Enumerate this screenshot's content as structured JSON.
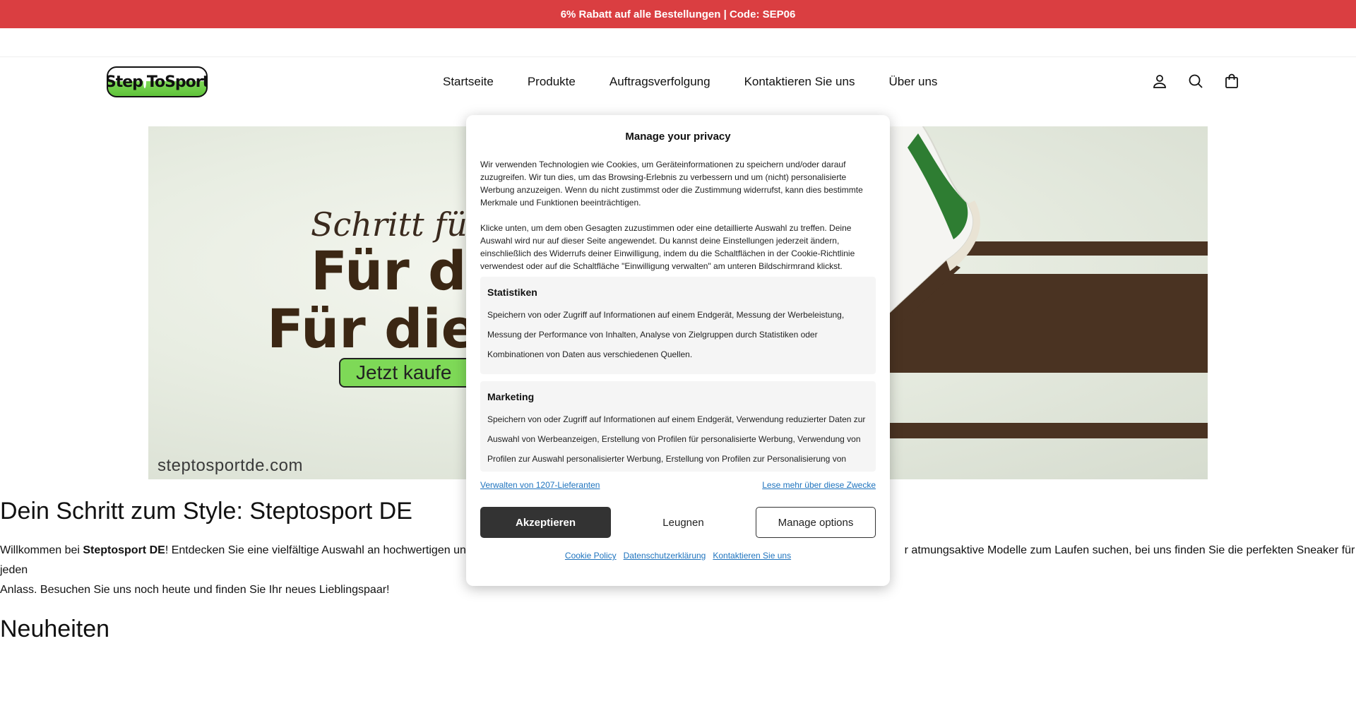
{
  "promo": {
    "text": "6% Rabatt auf alle Bestellungen | Code: SEP06"
  },
  "logo": {
    "text_left": "Step",
    "text_mid": "To",
    "text_right": "Sport"
  },
  "nav": {
    "items": [
      "Startseite",
      "Produkte",
      "Auftragsverfolgung",
      "Kontaktieren Sie uns",
      "Über uns"
    ]
  },
  "icons": [
    "account-icon",
    "search-icon",
    "cart-icon"
  ],
  "hero": {
    "script_text": "Schritt für St",
    "headline_1": "Für di",
    "headline_2": "Für die",
    "cta": "Jetzt kaufe",
    "domain": "steptosportde.com"
  },
  "content": {
    "heading": "Dein Schritt zum Style: Steptosport DE",
    "intro_prefix": "Willkommen bei ",
    "intro_brand": "Steptosport DE",
    "intro_visible_1": "! Entdecken Sie eine vielfältige Auswahl an hochwertigen und st",
    "intro_visible_2": "r atmungsaktive Modelle zum Laufen suchen, bei uns finden Sie die perfekten Sneaker für jeden",
    "intro_line_2": "Anlass. Besuchen Sie uns noch heute und finden Sie Ihr neues Lieblingspaar!",
    "section_heading": "Neuheiten"
  },
  "consent": {
    "title": "Manage your privacy",
    "paragraph_1": "Wir verwenden Technologien wie Cookies, um Geräteinformationen zu speichern und/oder darauf zuzugreifen. Wir tun dies, um das Browsing-Erlebnis zu verbessern und um (nicht) personalisierte Werbung anzuzeigen. Wenn du nicht zustimmst oder die Zustimmung widerrufst, kann dies bestimmte Merkmale und Funktionen beeinträchtigen.",
    "paragraph_2": "Klicke unten, um dem oben Gesagten zuzustimmen oder eine detaillierte Auswahl zu treffen. Deine Auswahl wird nur auf dieser Seite angewendet. Du kannst deine Einstellungen jederzeit ändern, einschließlich des Widerrufs deiner Einwilligung, indem du die Schaltflächen in der Cookie-Richtlinie verwendest oder auf die Schaltfläche \"Einwilligung verwalten\" am unteren Bildschirmrand klickst.",
    "categories": [
      {
        "title": "Statistiken",
        "description": "Speichern von oder Zugriff auf Informationen auf einem Endgerät, Messung der Werbeleistung, Messung der Performance von Inhalten, Analyse von Zielgruppen durch Statistiken oder Kombinationen von Daten aus verschiedenen Quellen."
      },
      {
        "title": "Marketing",
        "description": "Speichern von oder Zugriff auf Informationen auf einem Endgerät, Verwendung reduzierter Daten zur Auswahl von Werbeanzeigen, Erstellung von Profilen für personalisierte Werbung, Verwendung von Profilen zur Auswahl personalisierter Werbung, Erstellung von Profilen zur Personalisierung von"
      }
    ],
    "vendors_link": "Verwalten von 1207-Lieferanten",
    "purposes_link": "Lese mehr über diese Zwecke",
    "accept": "Akzeptieren",
    "deny": "Leugnen",
    "manage": "Manage options",
    "footer_links": [
      "Cookie Policy",
      "Datenschutzerklärung",
      "Kontaktieren Sie uns"
    ]
  }
}
